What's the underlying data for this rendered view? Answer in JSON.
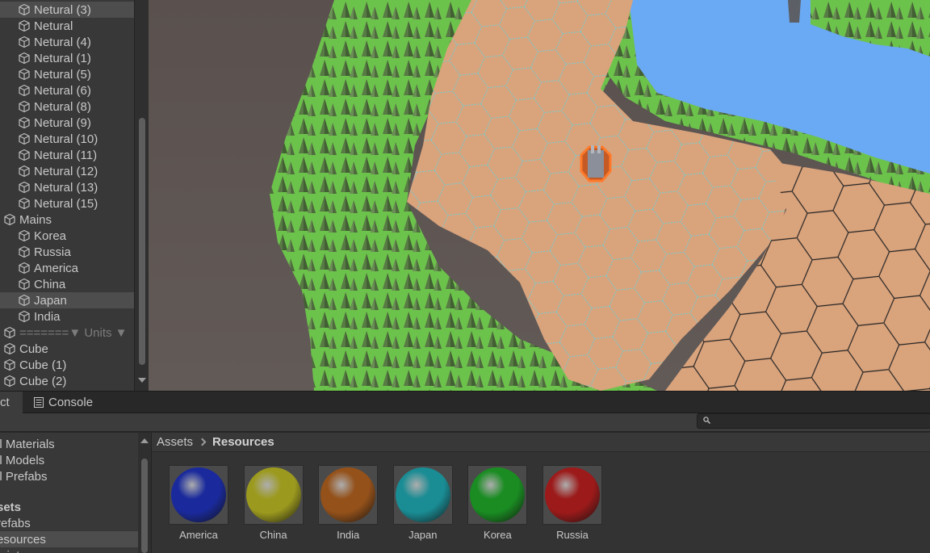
{
  "hierarchy": {
    "items": [
      {
        "label": "Netural (3)",
        "indent": 1,
        "selected": true
      },
      {
        "label": "Netural",
        "indent": 1
      },
      {
        "label": "Netural (4)",
        "indent": 1
      },
      {
        "label": "Netural (1)",
        "indent": 1
      },
      {
        "label": "Netural (5)",
        "indent": 1
      },
      {
        "label": "Netural (6)",
        "indent": 1
      },
      {
        "label": "Netural (8)",
        "indent": 1
      },
      {
        "label": "Netural (9)",
        "indent": 1
      },
      {
        "label": "Netural (10)",
        "indent": 1
      },
      {
        "label": "Netural (11)",
        "indent": 1
      },
      {
        "label": "Netural (12)",
        "indent": 1
      },
      {
        "label": "Netural (13)",
        "indent": 1
      },
      {
        "label": "Netural (15)",
        "indent": 1
      },
      {
        "label": "Mains",
        "indent": 0
      },
      {
        "label": "Korea",
        "indent": 1
      },
      {
        "label": "Russia",
        "indent": 1
      },
      {
        "label": "America",
        "indent": 1
      },
      {
        "label": "China",
        "indent": 1
      },
      {
        "label": "Japan",
        "indent": 1,
        "selected": true
      },
      {
        "label": "India",
        "indent": 1
      },
      {
        "label": "=======▼ Units ▼",
        "indent": 0,
        "dim": true
      },
      {
        "label": "Cube",
        "indent": 0
      },
      {
        "label": "Cube (1)",
        "indent": 0
      },
      {
        "label": "Cube (2)",
        "indent": 0
      }
    ]
  },
  "tabs": {
    "project_partial": "ct",
    "console": "Console"
  },
  "search": {
    "placeholder": ""
  },
  "folders": {
    "items": [
      {
        "label": "ll Materials",
        "bold": false
      },
      {
        "label": "ll Models",
        "bold": false
      },
      {
        "label": "ll Prefabs",
        "bold": false
      },
      {
        "label": "sets",
        "bold": true
      },
      {
        "label": "refabs",
        "bold": false
      },
      {
        "label": "esources",
        "bold": false,
        "selected": true
      },
      {
        "label": "cripts",
        "bold": false
      }
    ]
  },
  "breadcrumb": {
    "root": "Assets",
    "current": "Resources"
  },
  "materials": [
    {
      "name": "America",
      "color": "#1a2a9c"
    },
    {
      "name": "China",
      "color": "#9c9a1e"
    },
    {
      "name": "India",
      "color": "#94511a"
    },
    {
      "name": "Japan",
      "color": "#1a8c94"
    },
    {
      "name": "Korea",
      "color": "#1a8c22"
    },
    {
      "name": "Russia",
      "color": "#9c1a1a"
    }
  ],
  "colors": {
    "hex_fill": "#d9a37c",
    "grass": "#6cc34b",
    "water": "#6aa9f3",
    "tree": "#5d7f48"
  }
}
